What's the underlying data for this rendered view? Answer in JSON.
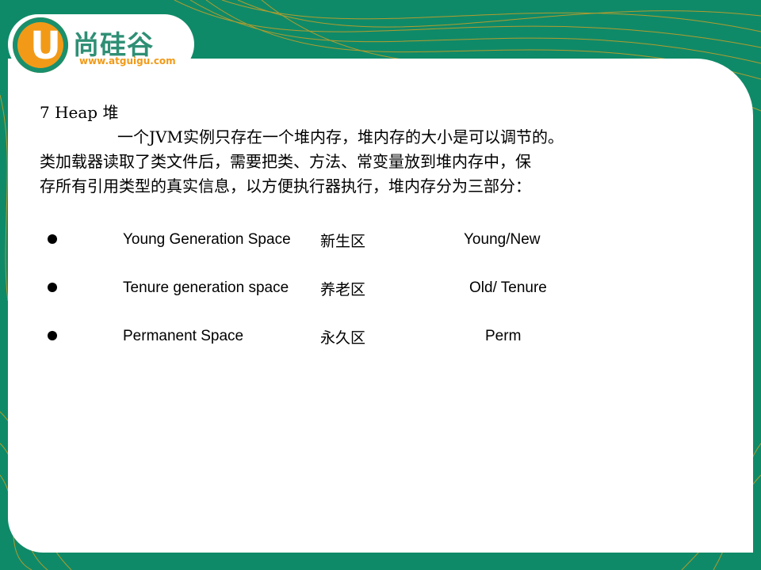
{
  "logo": {
    "letter": "U",
    "name": "尚硅谷",
    "url": "www.atguigu.com"
  },
  "section": {
    "heading": "7 Heap 堆",
    "paragraph_line1": "一个JVM实例只存在一个堆内存，堆内存的大小是可以调节的。",
    "paragraph_line2": "类加载器读取了类文件后，需要把类、方法、常变量放到堆内存中，保",
    "paragraph_line3": "存所有引用类型的真实信息，以方便执行器执行，堆内存分为三部分："
  },
  "heap_parts": [
    {
      "english": "Young Generation Space",
      "chinese": "新生区",
      "alias": "Young/New"
    },
    {
      "english": "Tenure generation space",
      "chinese": "养老区",
      "alias": "Old/ Tenure"
    },
    {
      "english": "Permanent Space",
      "chinese": "永久区",
      "alias": "Perm"
    }
  ],
  "colors": {
    "background_green": "#0f8a68",
    "accent_orange": "#f29a17",
    "logo_green": "#2f8f75",
    "panel": "#ffffff"
  }
}
